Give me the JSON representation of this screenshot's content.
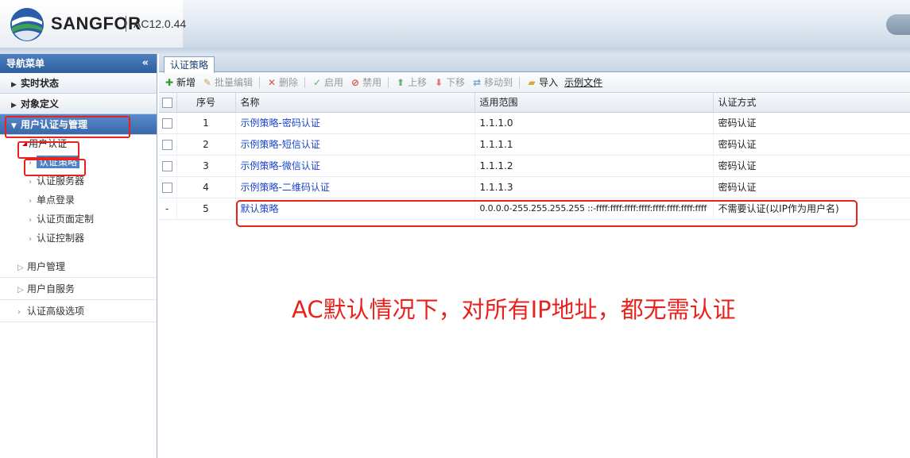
{
  "header": {
    "brand": "SANGFOR",
    "version": "AC12.0.44",
    "colors": {
      "brand_blue": "#2a5ea8",
      "brand_green": "#3fa34d"
    }
  },
  "sidebar": {
    "title": "导航菜单",
    "collapse_icon": "«",
    "groups": [
      {
        "label": "实时状态"
      },
      {
        "label": "对象定义"
      },
      {
        "label": "用户认证与管理"
      }
    ],
    "sub_head": "用户认证",
    "leaves": [
      {
        "label": "认证策略"
      },
      {
        "label": "认证服务器"
      },
      {
        "label": "单点登录"
      },
      {
        "label": "认证页面定制"
      },
      {
        "label": "认证控制器"
      }
    ],
    "plain_items": [
      {
        "label": "用户管理"
      },
      {
        "label": "用户自服务"
      },
      {
        "label": "认证高级选项"
      }
    ]
  },
  "main": {
    "tab": "认证策略",
    "toolbar": {
      "add": "新增",
      "batch_edit": "批量编辑",
      "delete": "删除",
      "enable": "启用",
      "disable": "禁用",
      "move_up": "上移",
      "move_down": "下移",
      "move_to": "移动到",
      "import": "导入",
      "example_file": "示例文件"
    },
    "columns": [
      "序号",
      "名称",
      "适用范围",
      "认证方式"
    ],
    "rows": [
      {
        "no": "1",
        "name": "示例策略-密码认证",
        "scope": "1.1.1.0",
        "method": "密码认证",
        "check": "box"
      },
      {
        "no": "2",
        "name": "示例策略-短信认证",
        "scope": "1.1.1.1",
        "method": "密码认证",
        "check": "box"
      },
      {
        "no": "3",
        "name": "示例策略-微信认证",
        "scope": "1.1.1.2",
        "method": "密码认证",
        "check": "box"
      },
      {
        "no": "4",
        "name": "示例策略-二维码认证",
        "scope": "1.1.1.3",
        "method": "密码认证",
        "check": "box"
      },
      {
        "no": "5",
        "name": "默认策略",
        "scope": "0.0.0.0-255.255.255.255 ::-ffff:ffff:ffff:ffff:ffff:ffff:ffff:ffff",
        "method": "不需要认证(以IP作为用户名)",
        "check": "-"
      }
    ]
  },
  "annotation": "AC默认情况下，对所有IP地址，都无需认证"
}
